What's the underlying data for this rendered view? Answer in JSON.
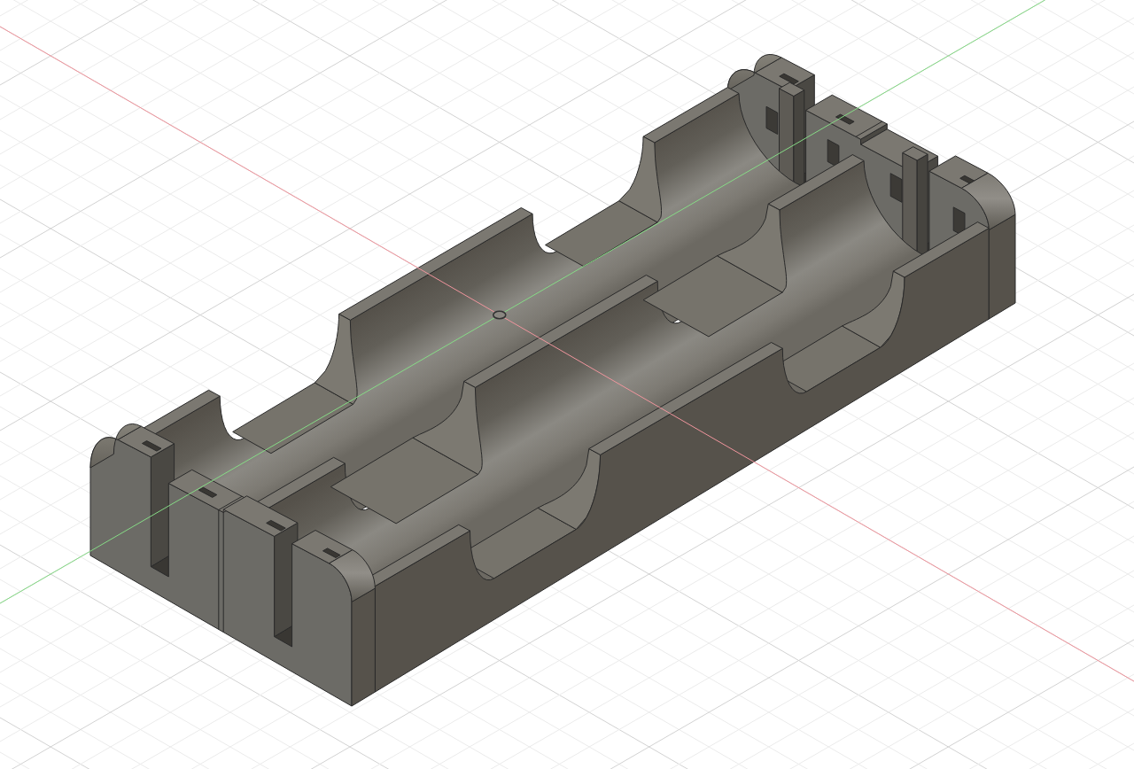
{
  "viewport": {
    "axes": [
      {
        "color": "#f0959d"
      },
      {
        "color": "#86db86"
      }
    ]
  }
}
